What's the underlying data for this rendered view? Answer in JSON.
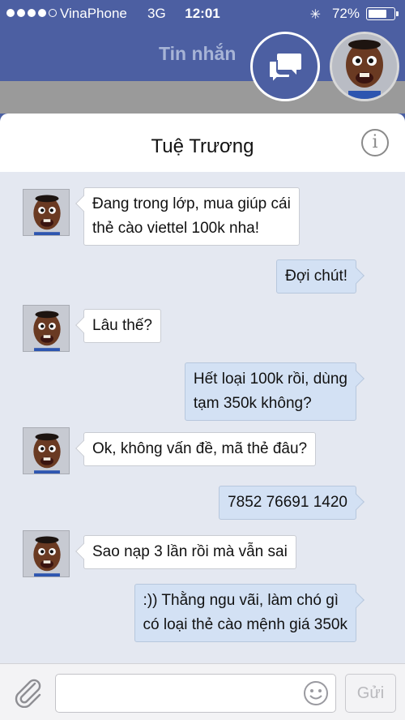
{
  "status_bar": {
    "carrier": "VinaPhone",
    "network": "3G",
    "time": "12:01",
    "battery_percent": "72%",
    "signal_dots_filled": 4,
    "signal_dots_total": 5
  },
  "header": {
    "title": "Tin nhắn",
    "chat_button_icon": "chat-bubbles-icon",
    "avatar": "profile-avatar"
  },
  "conversation": {
    "contact_name": "Tuệ Trương",
    "info_icon": "i",
    "messages": [
      {
        "direction": "in",
        "lines": [
          "Đang trong lớp, mua giúp cái",
          "thẻ cào viettel 100k nha!"
        ]
      },
      {
        "direction": "out",
        "lines": [
          "Đợi chút!"
        ]
      },
      {
        "direction": "in",
        "lines": [
          "Lâu thế?"
        ]
      },
      {
        "direction": "out",
        "lines": [
          "Hết loại 100k rồi, dùng",
          "tạm 350k không?"
        ]
      },
      {
        "direction": "in",
        "lines": [
          "Ok, không vấn đề, mã thẻ đâu?"
        ]
      },
      {
        "direction": "out",
        "lines": [
          "7852 76691 1420"
        ]
      },
      {
        "direction": "in",
        "lines": [
          "Sao nạp 3 lần rồi mà vẫn sai"
        ]
      },
      {
        "direction": "out",
        "lines": [
          ":)) Thằng ngu vãi, làm chó gì",
          "có loại thẻ cào mệnh giá 350k"
        ]
      }
    ]
  },
  "composer": {
    "input_value": "",
    "input_placeholder": "",
    "send_label": "Gửi",
    "attach_icon": "paperclip-icon",
    "emoji_icon": "smiley-icon"
  },
  "colors": {
    "header_bg": "#4c5fa2",
    "header_title": "#a7b4d6",
    "chat_bg": "#e4e8f1",
    "incoming_bubble": "#ffffff",
    "outgoing_bubble": "#d3e1f4"
  }
}
